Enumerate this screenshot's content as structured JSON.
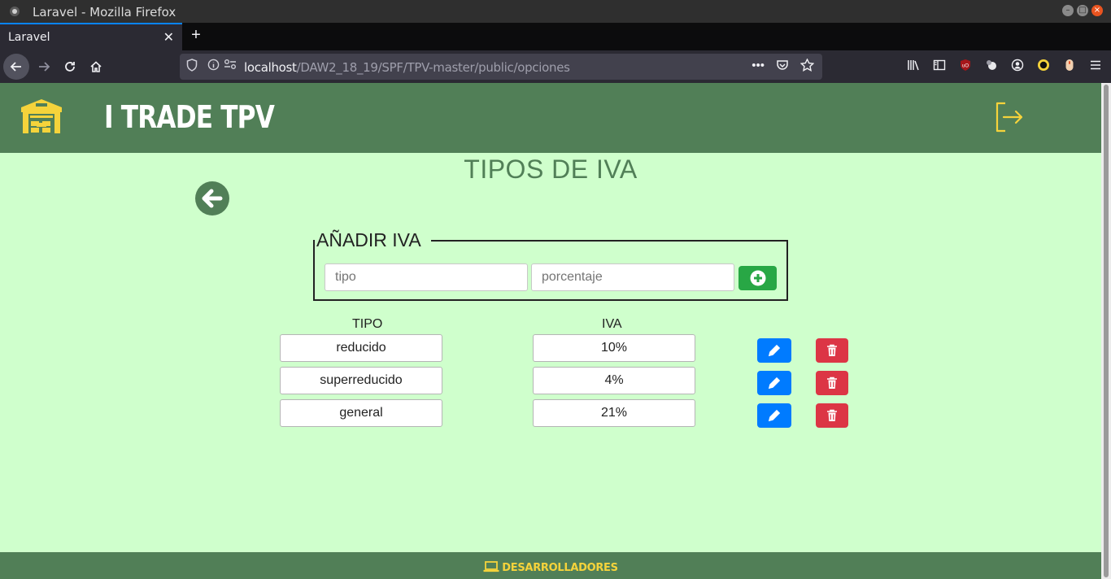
{
  "window": {
    "title": "Laravel - Mozilla Firefox"
  },
  "browser": {
    "tab_label": "Laravel",
    "tab_close": "✕",
    "new_tab": "+",
    "url_host": "localhost",
    "url_path": "/DAW2_18_19/SPF/TPV-master/public/opciones"
  },
  "header": {
    "brand": "I TRADE TPV"
  },
  "main": {
    "title": "TIPOS DE IVA",
    "add_legend": "AÑADIR IVA",
    "tipo_placeholder": "tipo",
    "porcentaje_placeholder": "porcentaje",
    "col_tipo": "TIPO",
    "col_iva": "IVA",
    "rows": [
      {
        "tipo": "reducido",
        "iva": "10%"
      },
      {
        "tipo": "superreducido",
        "iva": "4%"
      },
      {
        "tipo": "general",
        "iva": "21%"
      }
    ]
  },
  "footer": {
    "developers": "DESARROLLADORES"
  },
  "colors": {
    "header_green": "#517f57",
    "page_bg": "#cfffcc",
    "accent_yellow": "#f5d33b",
    "add_green": "#28a745",
    "edit_blue": "#007bff",
    "delete_red": "#dc3545"
  },
  "icons": [
    "warehouse-icon",
    "logout-icon",
    "arrow-left-circle-icon",
    "plus-circle-icon",
    "pencil-icon",
    "trash-icon",
    "laptop-icon"
  ]
}
